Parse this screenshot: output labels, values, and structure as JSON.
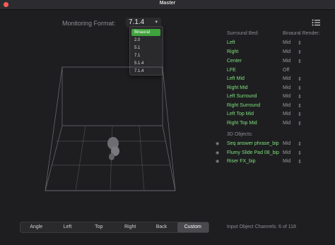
{
  "window": {
    "title": "Master"
  },
  "monitoring": {
    "label": "Monitoring Format:",
    "value": "7.1.4",
    "options": [
      "Binaural",
      "2.0",
      "5.1",
      "7.1",
      "5.1.4",
      "7.1.4"
    ],
    "selected": "Binaural"
  },
  "render_panel": {
    "col1": "Surround Bed:",
    "col2": "Binaural Render:",
    "bed": [
      {
        "name": "Left",
        "mode": "Mid"
      },
      {
        "name": "Right",
        "mode": "Mid"
      },
      {
        "name": "Center",
        "mode": "Mid"
      },
      {
        "name": "LFE",
        "mode": "Off"
      },
      {
        "name": "Left Mid",
        "mode": "Mid"
      },
      {
        "name": "Right Mid",
        "mode": "Mid"
      },
      {
        "name": "Left Surround",
        "mode": "Mid"
      },
      {
        "name": "Right Surround",
        "mode": "Mid"
      },
      {
        "name": "Left Top Mid",
        "mode": "Mid"
      },
      {
        "name": "Right Top Mid",
        "mode": "Mid"
      }
    ],
    "objects_label": "3D Objects:",
    "objects": [
      {
        "name": "Seq answer phrase_bip",
        "mode": "Mid"
      },
      {
        "name": "Flumy Slide Pad 08_bip",
        "mode": "Mid"
      },
      {
        "name": "Riser FX_bip",
        "mode": "Mid"
      }
    ],
    "footer": "Input Object Channels: 6 of 118"
  },
  "views": {
    "buttons": [
      "Angle",
      "Left",
      "Top",
      "Right",
      "Back",
      "Custom"
    ],
    "active": "Custom"
  },
  "colors": {
    "accent": "#3fa33c",
    "label_green": "#7fe07a",
    "background": "#1e1e21"
  },
  "icons": [
    "list-icon",
    "object-icon",
    "stepper-icon"
  ]
}
